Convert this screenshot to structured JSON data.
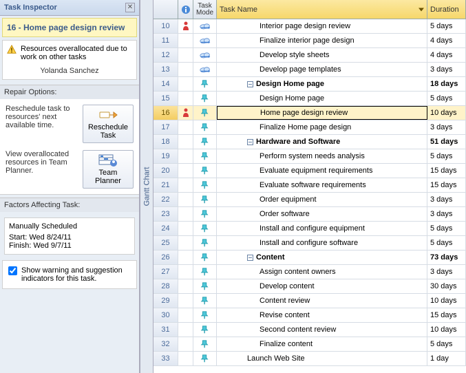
{
  "inspector": {
    "title": "Task Inspector",
    "task_title": "16 - Home page design review",
    "warning_text": "Resources overallocated due to work on other tasks",
    "warning_person": "Yolanda Sanchez",
    "repair_heading": "Repair Options:",
    "repair1_text": "Reschedule task to resources' next available time.",
    "repair1_btn": "Reschedule Task",
    "repair2_text": "View overallocated resources in Team Planner.",
    "repair2_btn": "Team Planner",
    "factors_heading": "Factors Affecting Task:",
    "factor_title": "Manually Scheduled",
    "factor_start": "Start: Wed 8/24/11",
    "factor_finish": "Finish: Wed 9/7/11",
    "chk_label": "Show warning and suggestion indicators for this task."
  },
  "gantt_label": "Gantt Chart",
  "columns": {
    "mode": "Task Mode",
    "name": "Task Name",
    "dur": "Duration"
  },
  "rows": [
    {
      "id": "10",
      "mode": "auto",
      "indent": 2,
      "name": "Interior page design review",
      "dur": "5 days",
      "warn": true
    },
    {
      "id": "11",
      "mode": "auto",
      "indent": 2,
      "name": "Finalize interior page design",
      "dur": "4 days"
    },
    {
      "id": "12",
      "mode": "auto",
      "indent": 2,
      "name": "Develop style sheets",
      "dur": "4 days"
    },
    {
      "id": "13",
      "mode": "auto",
      "indent": 2,
      "name": "Develop page templates",
      "dur": "3 days"
    },
    {
      "id": "14",
      "mode": "manual",
      "indent": 1,
      "summary": true,
      "name": "Design Home page",
      "dur": "18 days"
    },
    {
      "id": "15",
      "mode": "manual",
      "indent": 2,
      "name": "Design Home page",
      "dur": "5 days"
    },
    {
      "id": "16",
      "mode": "manual",
      "indent": 2,
      "name": "Home page design review",
      "dur": "10 days",
      "warn": true,
      "sel": true
    },
    {
      "id": "17",
      "mode": "manual",
      "indent": 2,
      "name": "Finalize Home page design",
      "dur": "3 days"
    },
    {
      "id": "18",
      "mode": "manual",
      "indent": 1,
      "summary": true,
      "name": "Hardware and Software",
      "dur": "51 days"
    },
    {
      "id": "19",
      "mode": "manual",
      "indent": 2,
      "name": "Perform system needs analysis",
      "dur": "5 days"
    },
    {
      "id": "20",
      "mode": "manual",
      "indent": 2,
      "name": "Evaluate equipment requirements",
      "dur": "15 days"
    },
    {
      "id": "21",
      "mode": "manual",
      "indent": 2,
      "name": "Evaluate software requirements",
      "dur": "15 days"
    },
    {
      "id": "22",
      "mode": "manual",
      "indent": 2,
      "name": "Order equipment",
      "dur": "3 days"
    },
    {
      "id": "23",
      "mode": "manual",
      "indent": 2,
      "name": "Order software",
      "dur": "3 days"
    },
    {
      "id": "24",
      "mode": "manual",
      "indent": 2,
      "name": "Install and configure equipment",
      "dur": "5 days"
    },
    {
      "id": "25",
      "mode": "manual",
      "indent": 2,
      "name": "Install and configure software",
      "dur": "5 days"
    },
    {
      "id": "26",
      "mode": "manual",
      "indent": 1,
      "summary": true,
      "name": "Content",
      "dur": "73 days"
    },
    {
      "id": "27",
      "mode": "manual",
      "indent": 2,
      "name": "Assign content owners",
      "dur": "3 days"
    },
    {
      "id": "28",
      "mode": "manual",
      "indent": 2,
      "name": "Develop content",
      "dur": "30 days"
    },
    {
      "id": "29",
      "mode": "manual",
      "indent": 2,
      "name": "Content review",
      "dur": "10 days"
    },
    {
      "id": "30",
      "mode": "manual",
      "indent": 2,
      "name": "Revise content",
      "dur": "15 days"
    },
    {
      "id": "31",
      "mode": "manual",
      "indent": 2,
      "name": "Second content review",
      "dur": "10 days"
    },
    {
      "id": "32",
      "mode": "manual",
      "indent": 2,
      "name": "Finalize content",
      "dur": "5 days"
    },
    {
      "id": "33",
      "mode": "manual",
      "indent": 1,
      "name": "Launch Web Site",
      "dur": "1 day"
    }
  ]
}
